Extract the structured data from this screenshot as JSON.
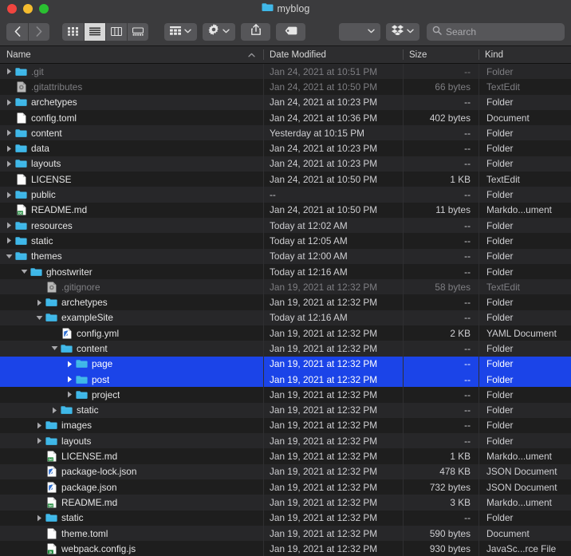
{
  "window": {
    "title": "myblog",
    "title_icon": "folder-icon",
    "traffic_lights": [
      "close",
      "minimize",
      "maximize"
    ]
  },
  "toolbar": {
    "back_label": "‹",
    "forward_label": "›",
    "view_modes": [
      {
        "name": "icon-view",
        "icon": "grid-icon",
        "active": false
      },
      {
        "name": "list-view",
        "icon": "list-icon",
        "active": true
      },
      {
        "name": "column-view",
        "icon": "columns-icon",
        "active": false
      },
      {
        "name": "gallery-view",
        "icon": "gallery-icon",
        "active": false
      }
    ],
    "group_button": {
      "name": "group-by-button",
      "icon": "group-icon"
    },
    "action_button": {
      "name": "action-gear-button",
      "icon": "gear-icon"
    },
    "share_button": {
      "name": "share-button",
      "icon": "share-icon"
    },
    "tag_button": {
      "name": "tag-button",
      "icon": "tag-icon"
    },
    "extra_dropdown": {
      "name": "extra-dropdown",
      "icon": "chevron-down-icon"
    },
    "dropbox_button": {
      "name": "dropbox-button",
      "icon": "dropbox-icon"
    },
    "search": {
      "placeholder": "Search",
      "value": "",
      "icon": "search-icon"
    }
  },
  "columns": {
    "name": "Name",
    "date_modified": "Date Modified",
    "size": "Size",
    "kind": "Kind",
    "sort_column": "Name",
    "sort_arrow": "^"
  },
  "rows": [
    {
      "name": ".git",
      "indent": 0,
      "twisty": "collapsed",
      "icon": "folder-icon",
      "date": "Jan 24, 2021 at 10:51 PM",
      "size": "--",
      "kind": "Folder",
      "dim": true,
      "selected": false
    },
    {
      "name": ".gitattributes",
      "indent": 0,
      "twisty": "none",
      "icon": "gear-doc-icon",
      "date": "Jan 24, 2021 at 10:50 PM",
      "size": "66 bytes",
      "kind": "TextEdit",
      "dim": true,
      "selected": false
    },
    {
      "name": "archetypes",
      "indent": 0,
      "twisty": "collapsed",
      "icon": "folder-icon",
      "date": "Jan 24, 2021 at 10:23 PM",
      "size": "--",
      "kind": "Folder",
      "dim": false,
      "selected": false
    },
    {
      "name": "config.toml",
      "indent": 0,
      "twisty": "none",
      "icon": "blank-doc-icon",
      "date": "Jan 24, 2021 at 10:36 PM",
      "size": "402 bytes",
      "kind": "Document",
      "dim": false,
      "selected": false
    },
    {
      "name": "content",
      "indent": 0,
      "twisty": "collapsed",
      "icon": "folder-icon",
      "date": "Yesterday at 10:15 PM",
      "size": "--",
      "kind": "Folder",
      "dim": false,
      "selected": false
    },
    {
      "name": "data",
      "indent": 0,
      "twisty": "collapsed",
      "icon": "folder-icon",
      "date": "Jan 24, 2021 at 10:23 PM",
      "size": "--",
      "kind": "Folder",
      "dim": false,
      "selected": false
    },
    {
      "name": "layouts",
      "indent": 0,
      "twisty": "collapsed",
      "icon": "folder-icon",
      "date": "Jan 24, 2021 at 10:23 PM",
      "size": "--",
      "kind": "Folder",
      "dim": false,
      "selected": false
    },
    {
      "name": "LICENSE",
      "indent": 0,
      "twisty": "none",
      "icon": "blank-doc-icon",
      "date": "Jan 24, 2021 at 10:50 PM",
      "size": "1 KB",
      "kind": "TextEdit",
      "dim": false,
      "selected": false
    },
    {
      "name": "public",
      "indent": 0,
      "twisty": "collapsed",
      "icon": "folder-icon",
      "date": "--",
      "size": "--",
      "kind": "Folder",
      "dim": false,
      "selected": false
    },
    {
      "name": "README.md",
      "indent": 0,
      "twisty": "none",
      "icon": "txt-doc-icon",
      "date": "Jan 24, 2021 at 10:50 PM",
      "size": "11 bytes",
      "kind": "Markdo...ument",
      "dim": false,
      "selected": false
    },
    {
      "name": "resources",
      "indent": 0,
      "twisty": "collapsed",
      "icon": "folder-icon",
      "date": "Today at 12:02 AM",
      "size": "--",
      "kind": "Folder",
      "dim": false,
      "selected": false
    },
    {
      "name": "static",
      "indent": 0,
      "twisty": "collapsed",
      "icon": "folder-icon",
      "date": "Today at 12:05 AM",
      "size": "--",
      "kind": "Folder",
      "dim": false,
      "selected": false
    },
    {
      "name": "themes",
      "indent": 0,
      "twisty": "expanded",
      "icon": "folder-icon",
      "date": "Today at 12:00 AM",
      "size": "--",
      "kind": "Folder",
      "dim": false,
      "selected": false
    },
    {
      "name": "ghostwriter",
      "indent": 1,
      "twisty": "expanded",
      "icon": "folder-icon",
      "date": "Today at 12:16 AM",
      "size": "--",
      "kind": "Folder",
      "dim": false,
      "selected": false
    },
    {
      "name": ".gitignore",
      "indent": 2,
      "twisty": "none",
      "icon": "gear-doc-icon",
      "date": "Jan 19, 2021 at 12:32 PM",
      "size": "58 bytes",
      "kind": "TextEdit",
      "dim": true,
      "selected": false
    },
    {
      "name": "archetypes",
      "indent": 2,
      "twisty": "collapsed",
      "icon": "folder-icon",
      "date": "Jan 19, 2021 at 12:32 PM",
      "size": "--",
      "kind": "Folder",
      "dim": false,
      "selected": false
    },
    {
      "name": "exampleSite",
      "indent": 2,
      "twisty": "expanded",
      "icon": "folder-icon",
      "date": "Today at 12:16 AM",
      "size": "--",
      "kind": "Folder",
      "dim": false,
      "selected": false
    },
    {
      "name": "config.yml",
      "indent": 3,
      "twisty": "none",
      "icon": "yaml-doc-icon",
      "date": "Jan 19, 2021 at 12:32 PM",
      "size": "2 KB",
      "kind": "YAML Document",
      "dim": false,
      "selected": false
    },
    {
      "name": "content",
      "indent": 3,
      "twisty": "expanded",
      "icon": "folder-icon",
      "date": "Jan 19, 2021 at 12:32 PM",
      "size": "--",
      "kind": "Folder",
      "dim": false,
      "selected": false
    },
    {
      "name": "page",
      "indent": 4,
      "twisty": "collapsed",
      "icon": "folder-icon",
      "date": "Jan 19, 2021 at 12:32 PM",
      "size": "--",
      "kind": "Folder",
      "dim": false,
      "selected": true
    },
    {
      "name": "post",
      "indent": 4,
      "twisty": "collapsed",
      "icon": "folder-icon",
      "date": "Jan 19, 2021 at 12:32 PM",
      "size": "--",
      "kind": "Folder",
      "dim": false,
      "selected": true
    },
    {
      "name": "project",
      "indent": 4,
      "twisty": "collapsed",
      "icon": "folder-icon",
      "date": "Jan 19, 2021 at 12:32 PM",
      "size": "--",
      "kind": "Folder",
      "dim": false,
      "selected": false
    },
    {
      "name": "static",
      "indent": 3,
      "twisty": "collapsed",
      "icon": "folder-icon",
      "date": "Jan 19, 2021 at 12:32 PM",
      "size": "--",
      "kind": "Folder",
      "dim": false,
      "selected": false
    },
    {
      "name": "images",
      "indent": 2,
      "twisty": "collapsed",
      "icon": "folder-icon",
      "date": "Jan 19, 2021 at 12:32 PM",
      "size": "--",
      "kind": "Folder",
      "dim": false,
      "selected": false
    },
    {
      "name": "layouts",
      "indent": 2,
      "twisty": "collapsed",
      "icon": "folder-icon",
      "date": "Jan 19, 2021 at 12:32 PM",
      "size": "--",
      "kind": "Folder",
      "dim": false,
      "selected": false
    },
    {
      "name": "LICENSE.md",
      "indent": 2,
      "twisty": "none",
      "icon": "txt-doc-icon",
      "date": "Jan 19, 2021 at 12:32 PM",
      "size": "1 KB",
      "kind": "Markdo...ument",
      "dim": false,
      "selected": false
    },
    {
      "name": "package-lock.json",
      "indent": 2,
      "twisty": "none",
      "icon": "yaml-doc-icon",
      "date": "Jan 19, 2021 at 12:32 PM",
      "size": "478 KB",
      "kind": "JSON Document",
      "dim": false,
      "selected": false
    },
    {
      "name": "package.json",
      "indent": 2,
      "twisty": "none",
      "icon": "yaml-doc-icon",
      "date": "Jan 19, 2021 at 12:32 PM",
      "size": "732 bytes",
      "kind": "JSON Document",
      "dim": false,
      "selected": false
    },
    {
      "name": "README.md",
      "indent": 2,
      "twisty": "none",
      "icon": "txt-doc-icon",
      "date": "Jan 19, 2021 at 12:32 PM",
      "size": "3 KB",
      "kind": "Markdo...ument",
      "dim": false,
      "selected": false
    },
    {
      "name": "static",
      "indent": 2,
      "twisty": "collapsed",
      "icon": "folder-icon",
      "date": "Jan 19, 2021 at 12:32 PM",
      "size": "--",
      "kind": "Folder",
      "dim": false,
      "selected": false
    },
    {
      "name": "theme.toml",
      "indent": 2,
      "twisty": "none",
      "icon": "blank-doc-icon",
      "date": "Jan 19, 2021 at 12:32 PM",
      "size": "590 bytes",
      "kind": "Document",
      "dim": false,
      "selected": false
    },
    {
      "name": "webpack.config.js",
      "indent": 2,
      "twisty": "none",
      "icon": "js-doc-icon",
      "date": "Jan 19, 2021 at 12:32 PM",
      "size": "930 bytes",
      "kind": "JavaSc...rce File",
      "dim": false,
      "selected": false
    }
  ],
  "colors": {
    "selection": "#1b44e8",
    "folder": "#3eb7e8",
    "titlebar": "#3b3b3d",
    "background": "#1e1e1e"
  }
}
